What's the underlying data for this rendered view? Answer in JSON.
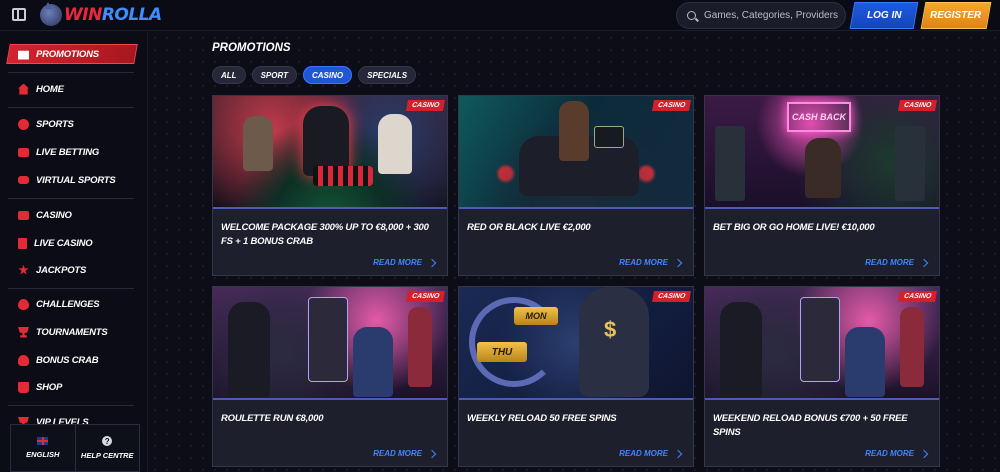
{
  "header": {
    "logo": "WinRolla",
    "search_placeholder": "Games, Categories, Providers",
    "login_label": "LOG IN",
    "register_label": "REGISTER"
  },
  "sidebar": {
    "promotions": "PROMOTIONS",
    "items": [
      {
        "label": "HOME",
        "icon": "home-icon"
      },
      {
        "label": "SPORTS",
        "icon": "ball-icon"
      },
      {
        "label": "LIVE BETTING",
        "icon": "tv-icon"
      },
      {
        "label": "VIRTUAL SPORTS",
        "icon": "gamepad-icon"
      },
      {
        "label": "CASINO",
        "icon": "slot-icon"
      },
      {
        "label": "LIVE CASINO",
        "icon": "cards-icon"
      },
      {
        "label": "JACKPOTS",
        "icon": "star-icon"
      },
      {
        "label": "CHALLENGES",
        "icon": "medal-icon"
      },
      {
        "label": "TOURNAMENTS",
        "icon": "trophy-icon"
      },
      {
        "label": "BONUS CRAB",
        "icon": "crab-icon"
      },
      {
        "label": "SHOP",
        "icon": "bag-icon"
      },
      {
        "label": "VIP LEVELS",
        "icon": "crown-icon"
      }
    ],
    "footer": {
      "language": "ENGLISH",
      "help": "HELP CENTRE"
    }
  },
  "main": {
    "title": "PROMOTIONS",
    "filters": [
      {
        "label": "ALL",
        "active": false
      },
      {
        "label": "SPORT",
        "active": false
      },
      {
        "label": "CASINO",
        "active": true
      },
      {
        "label": "SPECIALS",
        "active": false
      }
    ],
    "cards": [
      {
        "tag": "CASINO",
        "title": "WELCOME PACKAGE 300% UP TO €8,000 + 300 FS + 1 BONUS CRAB",
        "more": "READ MORE"
      },
      {
        "tag": "CASINO",
        "title": "RED OR BLACK LIVE €2,000",
        "more": "READ MORE"
      },
      {
        "tag": "CASINO",
        "title": "BET BIG OR GO HOME LIVE! €10,000",
        "more": "READ MORE"
      },
      {
        "tag": "CASINO",
        "title": "ROULETTE RUN €8,000",
        "more": "READ MORE"
      },
      {
        "tag": "CASINO",
        "title": "WEEKLY RELOAD 50 FREE SPINS",
        "more": "READ MORE"
      },
      {
        "tag": "CASINO",
        "title": "WEEKEND RELOAD BONUS €700 + 50 FREE SPINS",
        "more": "READ MORE"
      }
    ],
    "art_text": {
      "cash_back": "CASH BACK",
      "mon": "MON",
      "thu": "THU"
    }
  }
}
